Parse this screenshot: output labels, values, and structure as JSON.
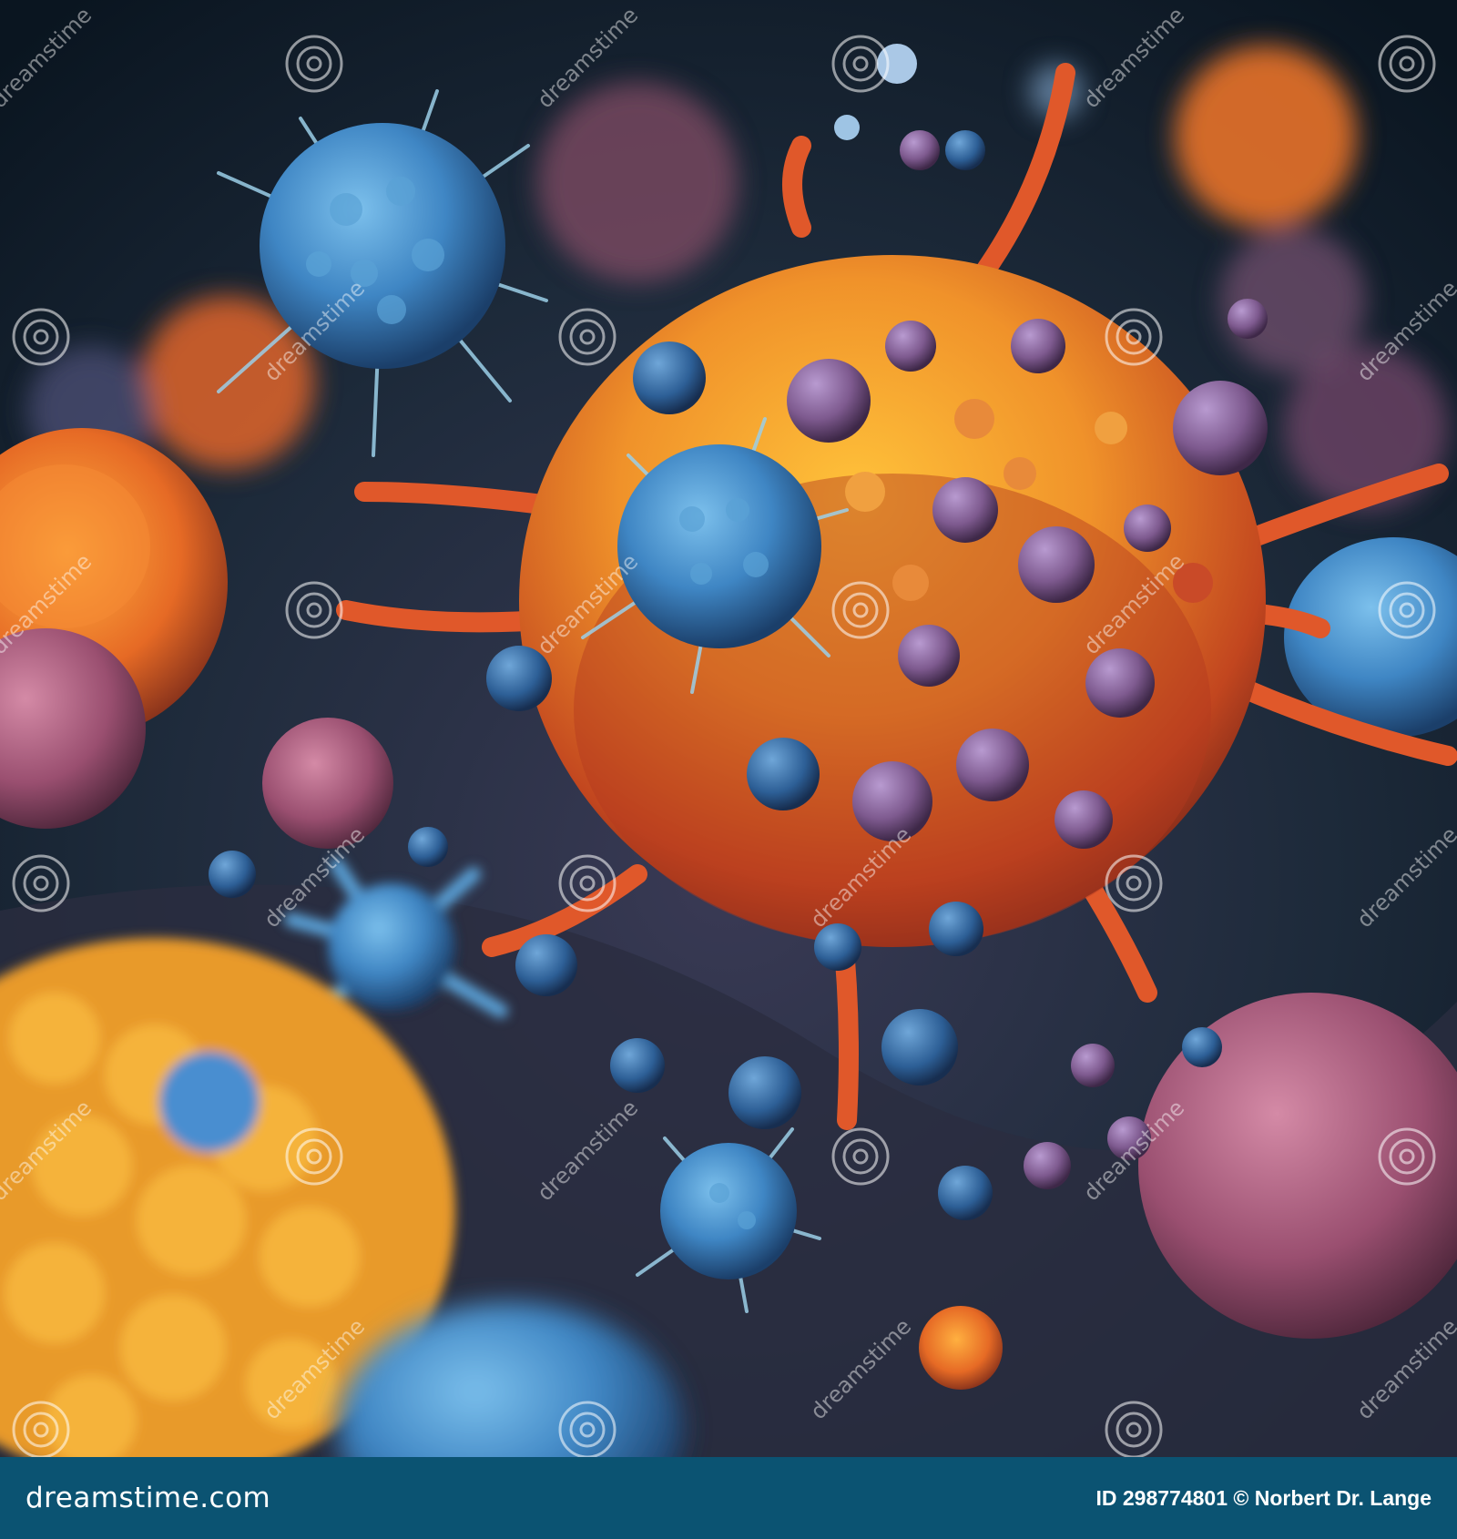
{
  "image": {
    "alt_subject": "3D illustration of immune cells and viruses",
    "palette": {
      "background": "#0d1a24",
      "orange": "#f0922a",
      "blue": "#3f86c4",
      "purple": "#7e5a8f",
      "footer": "#0b5372"
    }
  },
  "watermark": {
    "text": "dreamstime",
    "icon": "dreamstime-swirl-icon"
  },
  "footer": {
    "brand": "dreamstime.com",
    "credit": "ID 298774801 © Norbert Dr. Lange"
  }
}
